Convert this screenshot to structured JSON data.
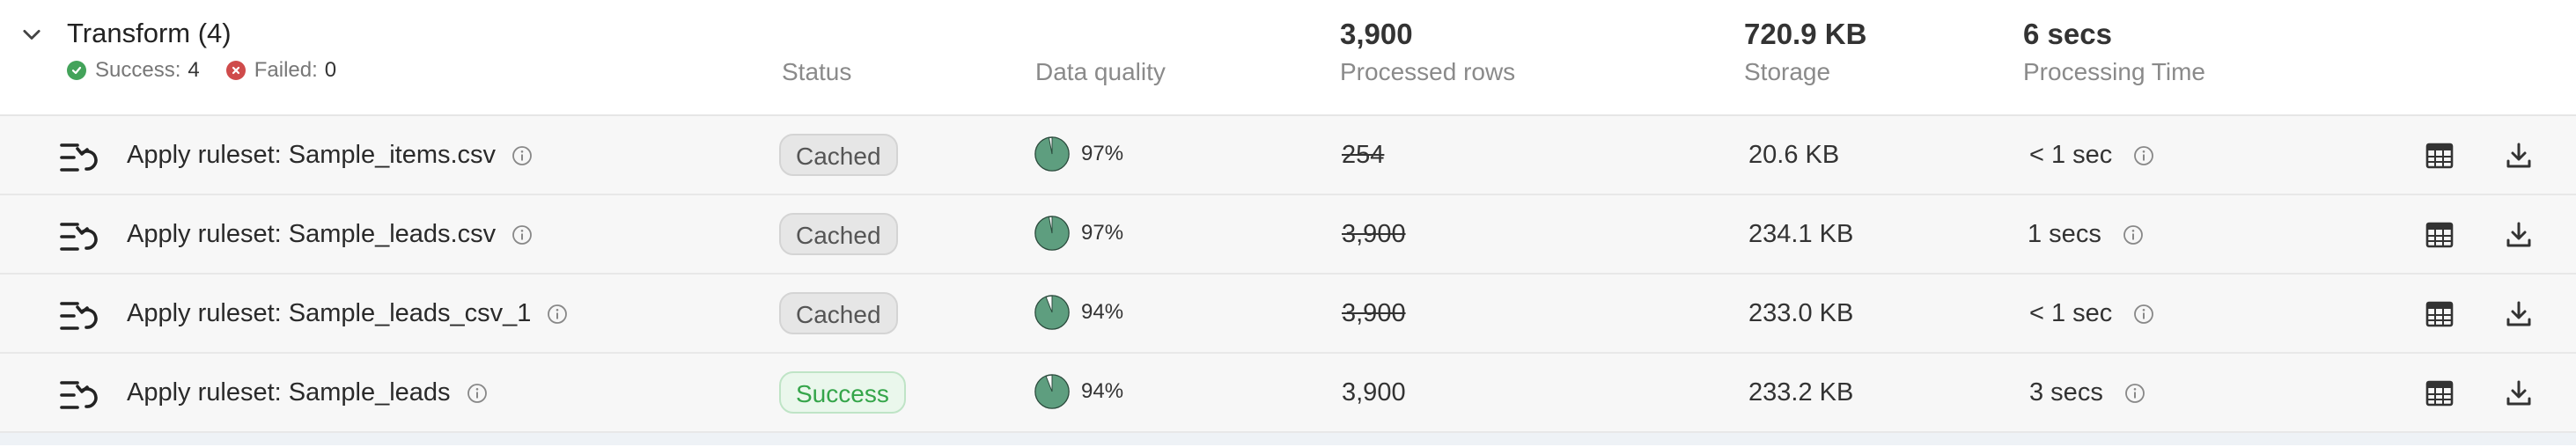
{
  "group": {
    "title": "Transform (4)",
    "success_label": "Success:",
    "success_count": "4",
    "failed_label": "Failed:",
    "failed_count": "0"
  },
  "columns": {
    "status": "Status",
    "quality": "Data quality",
    "rows_total": "3,900",
    "rows_label": "Processed rows",
    "storage_total": "720.9 KB",
    "storage_label": "Storage",
    "time_total": "6 secs",
    "time_label": "Processing Time"
  },
  "rows": [
    {
      "name": "Apply ruleset: Sample_items.csv",
      "status": "Cached",
      "quality": "97%",
      "quality_value": 0.97,
      "rows": "254",
      "storage": "20.6 KB",
      "time": "< 1 sec"
    },
    {
      "name": "Apply ruleset: Sample_leads.csv",
      "status": "Cached",
      "quality": "97%",
      "quality_value": 0.97,
      "rows": "3,900",
      "storage": "234.1 KB",
      "time": "1 secs"
    },
    {
      "name": "Apply ruleset: Sample_leads_csv_1",
      "status": "Cached",
      "quality": "94%",
      "quality_value": 0.94,
      "rows": "3,900",
      "storage": "233.0 KB",
      "time": "< 1 sec"
    },
    {
      "name": "Apply ruleset: Sample_leads",
      "status": "Success",
      "quality": "94%",
      "quality_value": 0.94,
      "rows": "3,900",
      "storage": "233.2 KB",
      "time": "3 secs"
    }
  ],
  "colors": {
    "quality_fill": "#5e9e7f",
    "success": "#35a54a",
    "failed": "#cf4b4b"
  },
  "icons": {
    "expand": "chevron-down-icon",
    "row": "ruleset-icon",
    "info": "info-icon",
    "table": "table-view-icon",
    "download": "download-icon"
  }
}
